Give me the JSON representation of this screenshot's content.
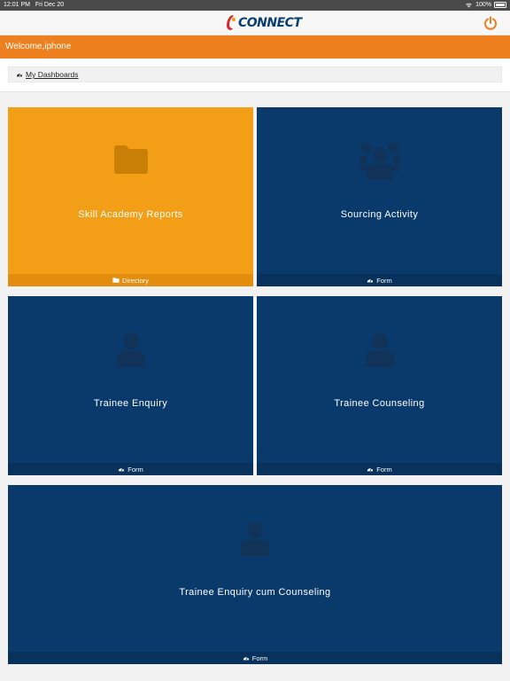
{
  "status_bar": {
    "time": "12:01 PM",
    "date": "Fri Dec 20",
    "battery": "100%"
  },
  "nav": {
    "logo_text": "CONNECT",
    "logo_mark": "i",
    "power_icon": "power-icon"
  },
  "welcome": {
    "text": "Welcome,iphone"
  },
  "breadcrumb": {
    "label": "My Dashboards",
    "icon": "dashboard-gauge-icon"
  },
  "colors": {
    "orange_header": "#ee7f1e",
    "tile_orange": "#f29e17",
    "tile_navy": "#0a3a6b"
  },
  "tiles": [
    {
      "title": "Skill Academy Reports",
      "footer": "Directory",
      "icon": "folder-icon",
      "footer_icon": "folder-icon"
    },
    {
      "title": "Sourcing Activity",
      "footer": "Form",
      "icon": "users-group-icon",
      "footer_icon": "dashboard-gauge-icon"
    },
    {
      "title": "Trainee Enquiry",
      "footer": "Form",
      "icon": "user-icon",
      "footer_icon": "dashboard-gauge-icon"
    },
    {
      "title": "Trainee Counseling",
      "footer": "Form",
      "icon": "user-icon",
      "footer_icon": "dashboard-gauge-icon"
    },
    {
      "title": "Trainee Enquiry cum Counseling",
      "footer": "Form",
      "icon": "user-icon",
      "footer_icon": "dashboard-gauge-icon"
    }
  ]
}
